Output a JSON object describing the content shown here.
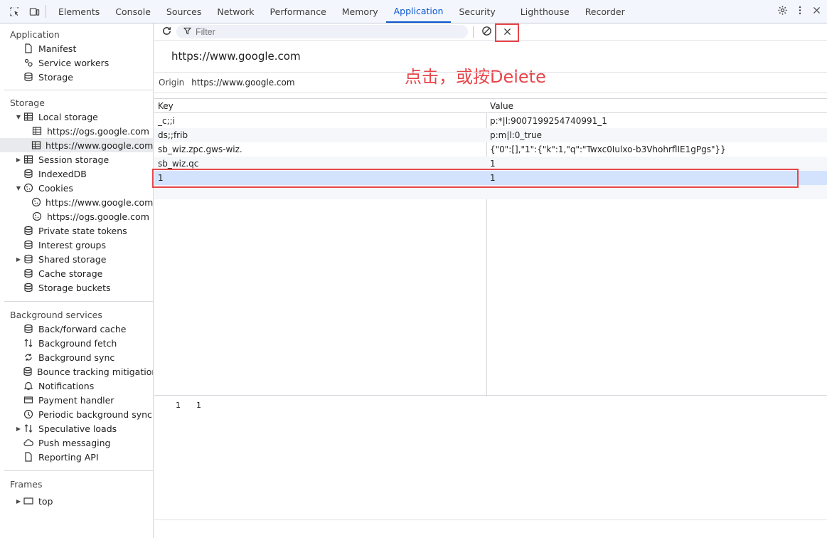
{
  "tabbar": {
    "tabs": [
      {
        "label": "Elements",
        "active": false
      },
      {
        "label": "Console",
        "active": false
      },
      {
        "label": "Sources",
        "active": false
      },
      {
        "label": "Network",
        "active": false
      },
      {
        "label": "Performance",
        "active": false
      },
      {
        "label": "Memory",
        "active": false
      },
      {
        "label": "Application",
        "active": true
      },
      {
        "label": "Security",
        "active": false
      },
      {
        "label": "Lighthouse",
        "active": false
      },
      {
        "label": "Recorder",
        "active": false
      }
    ],
    "accent": "#0b57d0"
  },
  "sidebar": {
    "application": {
      "title": "Application",
      "items": [
        "Manifest",
        "Service workers",
        "Storage"
      ]
    },
    "storage": {
      "title": "Storage",
      "local_storage": "Local storage",
      "local_children": [
        "https://ogs.google.com",
        "https://www.google.com"
      ],
      "session_storage": "Session storage",
      "indexeddb": "IndexedDB",
      "cookies": "Cookies",
      "cookie_children": [
        "https://www.google.com",
        "https://ogs.google.com"
      ],
      "private_state_tokens": "Private state tokens",
      "interest_groups": "Interest groups",
      "shared_storage": "Shared storage",
      "cache_storage": "Cache storage",
      "storage_buckets": "Storage buckets"
    },
    "background": {
      "title": "Background services",
      "items": [
        "Back/forward cache",
        "Background fetch",
        "Background sync",
        "Bounce tracking mitigations",
        "Notifications",
        "Payment handler",
        "Periodic background sync",
        "Speculative loads",
        "Push messaging",
        "Reporting API"
      ]
    },
    "frames": {
      "title": "Frames",
      "top": "top"
    }
  },
  "toolbar": {
    "filter_placeholder": "Filter"
  },
  "main": {
    "origin_heading": "https://www.google.com",
    "annotation": "点击，或按Delete",
    "origin_label": "Origin",
    "origin_value": "https://www.google.com",
    "annotation_color": "#e8454a"
  },
  "table": {
    "headers": [
      "Key",
      "Value"
    ],
    "rows": [
      {
        "key": "_c;;i",
        "value": "p:*|l:9007199254740991_1"
      },
      {
        "key": "ds;;frib",
        "value": "p:m|l:0_true"
      },
      {
        "key": "sb_wiz.zpc.gws-wiz.",
        "value": "{\"0\":[],\"1\":{\"k\":1,\"q\":\"Twxc0Iulxo-b3VhohrflIE1gPgs\"}}"
      },
      {
        "key": "sb_wiz.qc",
        "value": "1"
      },
      {
        "key": "1",
        "value": "1"
      }
    ],
    "selected_row": 4
  },
  "preview": {
    "line_number": "1",
    "value": "1"
  }
}
